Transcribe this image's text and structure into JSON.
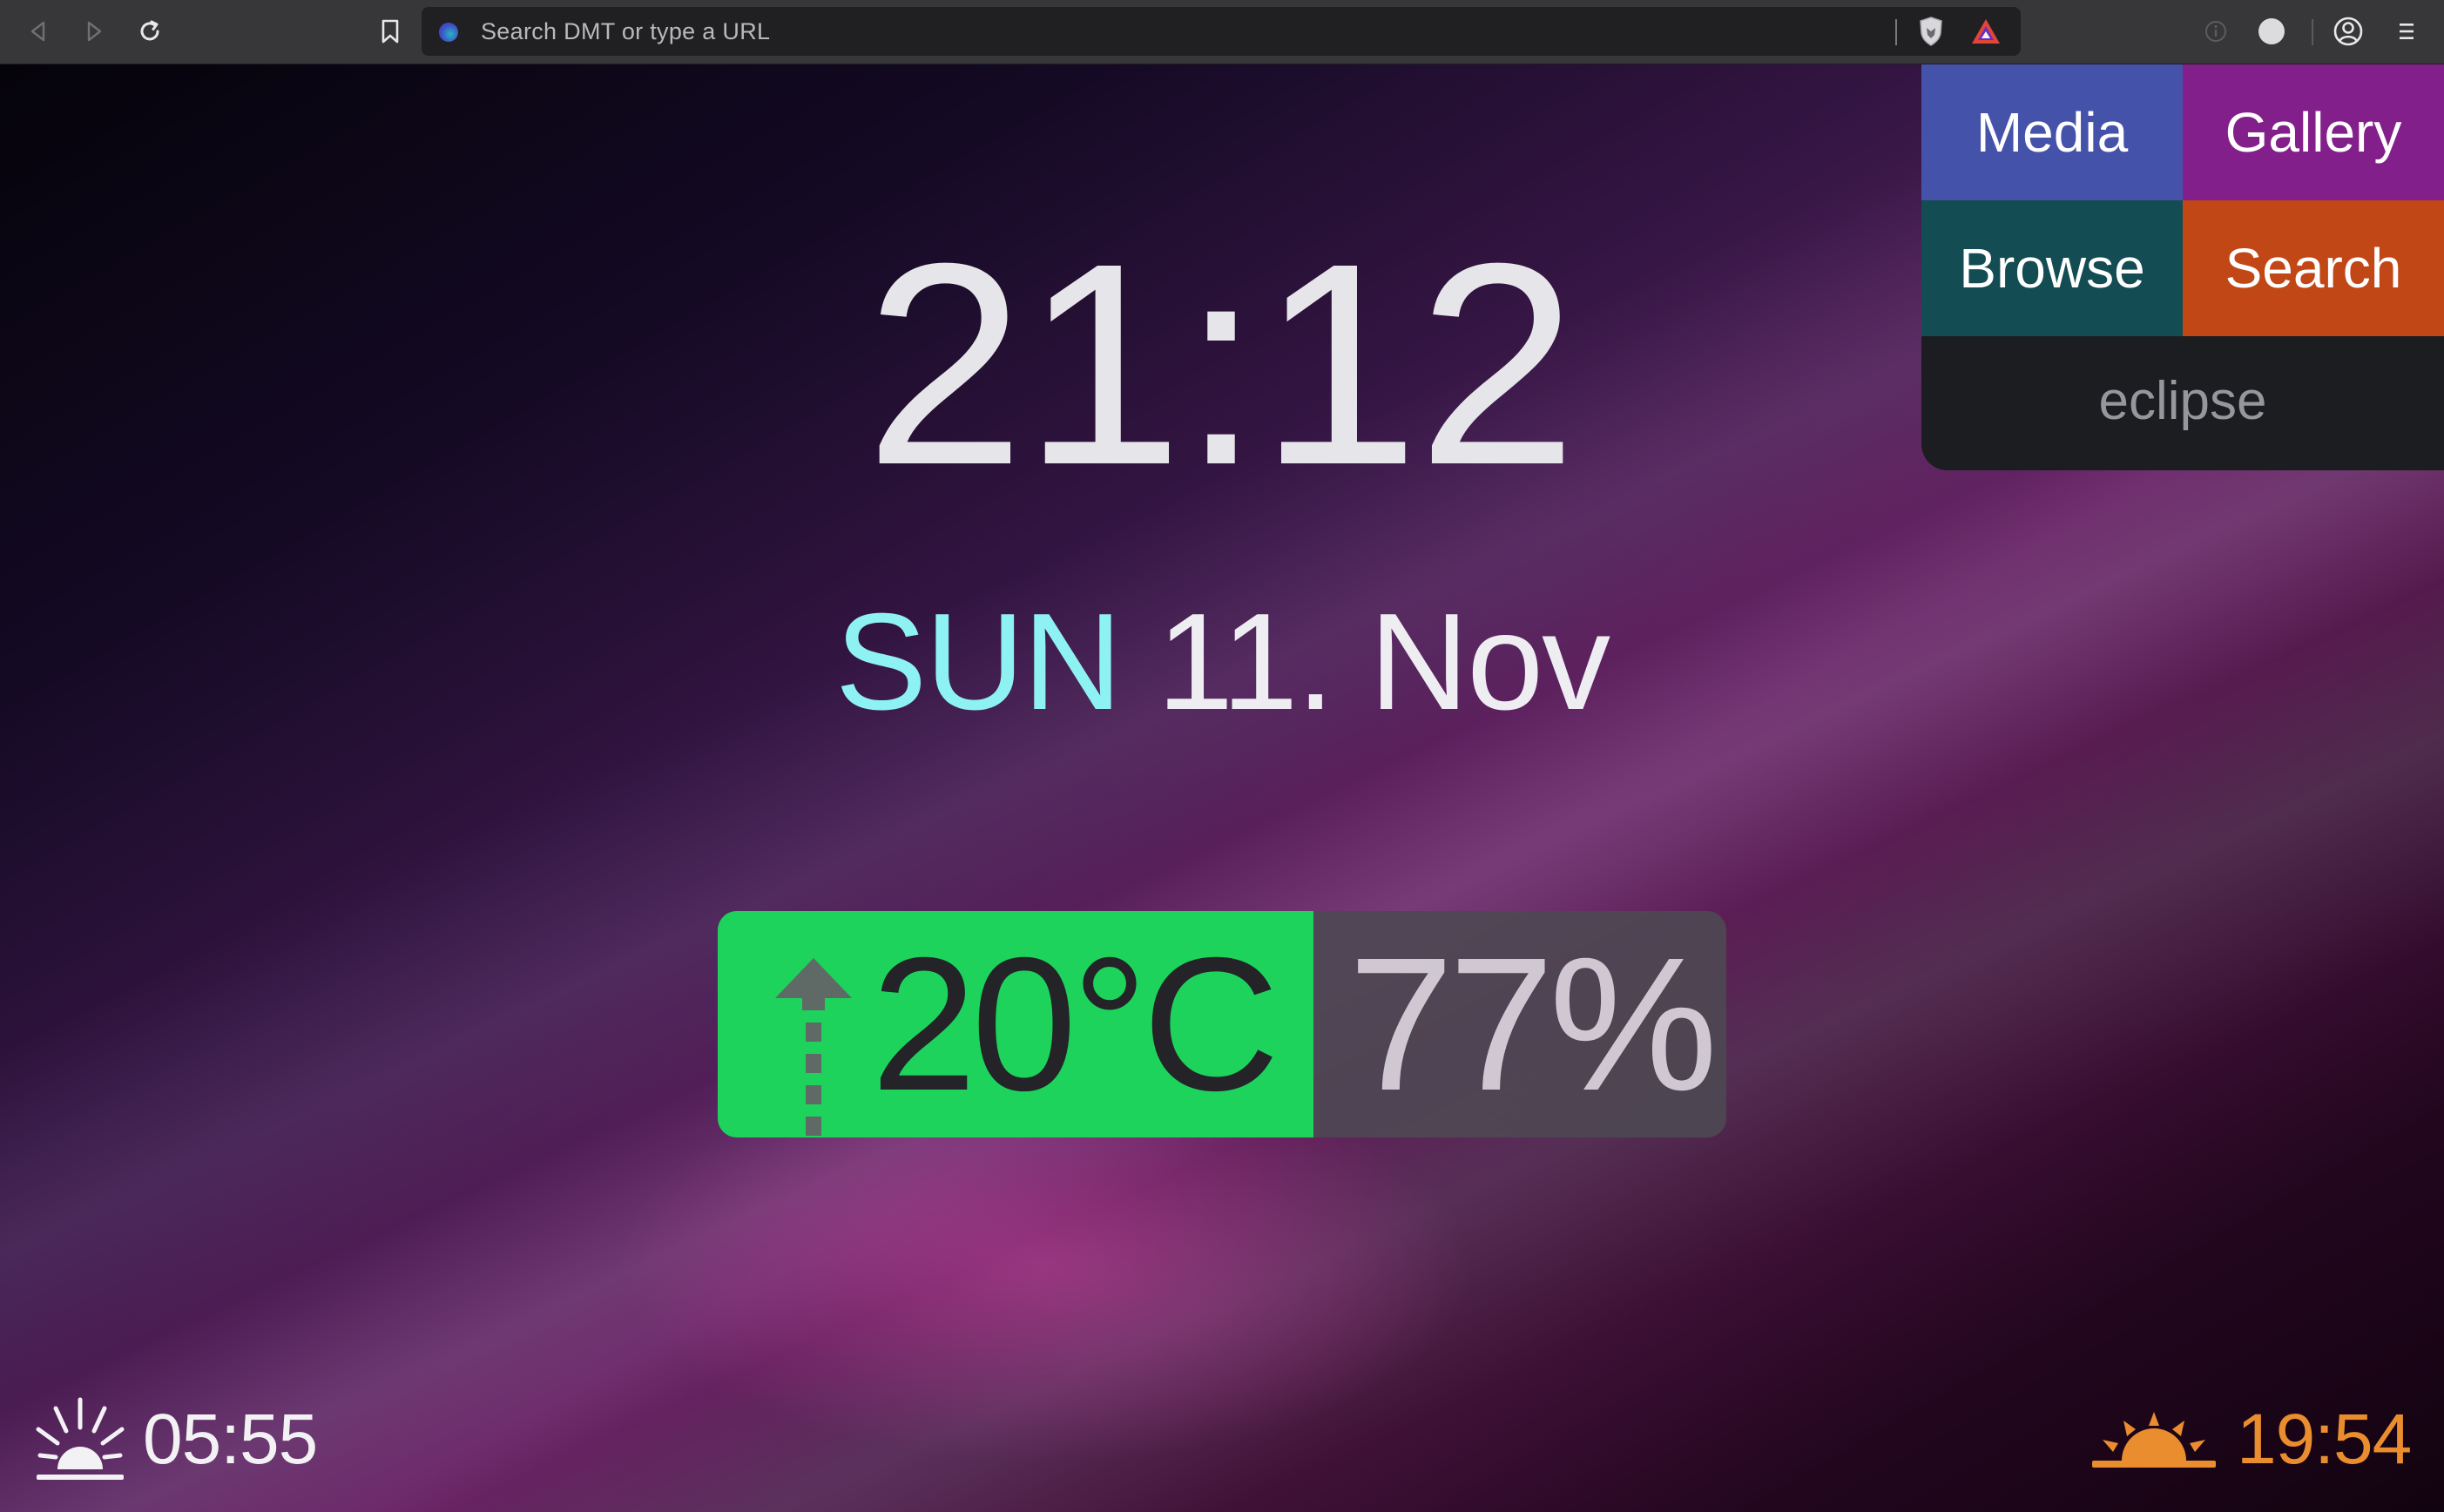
{
  "browser": {
    "url_placeholder": "Search DMT or type a URL"
  },
  "icons": {
    "back": "back-arrow-icon",
    "forward": "forward-arrow-icon",
    "reload": "reload-icon",
    "bookmark": "bookmark-icon",
    "brave_shield": "brave-shield-icon",
    "brave_rewards": "brave-rewards-icon",
    "info": "info-icon",
    "profile": "profile-icon",
    "menu": "hamburger-menu-icon",
    "sunrise": "sunrise-icon",
    "sunset": "sunset-icon",
    "trend": "rising-arrow-icon"
  },
  "clock": {
    "time": "21:12",
    "day": "SUN",
    "date": "11. Nov"
  },
  "weather": {
    "temperature": "20°C",
    "humidity": "77%"
  },
  "links": {
    "media": "Media",
    "gallery": "Gallery",
    "browse": "Browse",
    "search": "Search",
    "footer": "eclipse"
  },
  "sun": {
    "sunrise": "05:55",
    "sunset": "19:54"
  },
  "colors": {
    "media": "#4552aa",
    "gallery": "#831f8a",
    "browse": "#134c52",
    "search": "#c24716",
    "temperature_bg": "#1dd35c",
    "day_accent": "#8ff2f2",
    "sunset_accent": "#ea8d2e"
  }
}
